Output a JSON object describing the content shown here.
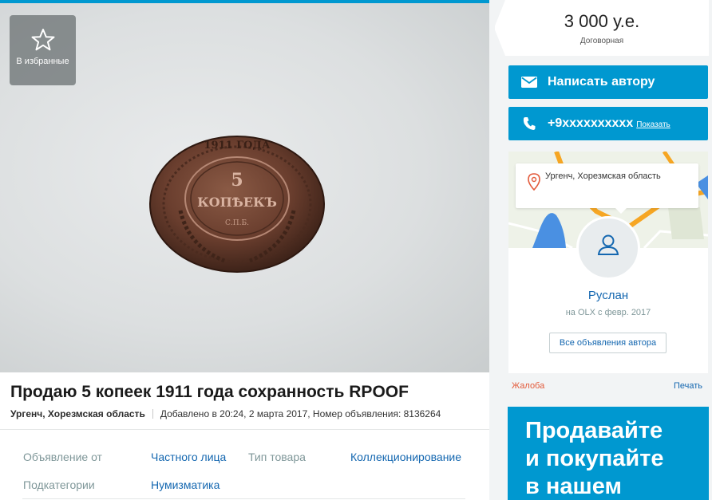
{
  "gallery": {
    "favorite_label": "В избранные"
  },
  "listing": {
    "title": "Продаю 5 копеек 1911 года сохранность RPOOF",
    "location": "Ургенч, Хорезмская область",
    "added": "Добавлено в 20:24, 2 марта 2017, Номер объявления: 8136264",
    "params": [
      {
        "label": "Объявление от",
        "value": "Частного лица"
      },
      {
        "label": "Тип товара",
        "value": "Коллекционирование"
      },
      {
        "label": "Подкатегории",
        "value": "Нумизматика"
      }
    ]
  },
  "price": {
    "amount": "3 000 у.е.",
    "note": "Договорная"
  },
  "contact": {
    "write_label": "Написать автору",
    "phone": "+9xxxxxxxxxx",
    "show_label": "Показать"
  },
  "seller": {
    "map_location": "Ургенч, Хорезмская область",
    "name": "Руслан",
    "since": "на OLX с февр. 2017",
    "all_ads_label": "Все объявления автора"
  },
  "actions": {
    "complain": "Жалоба",
    "print": "Печать"
  },
  "promo": {
    "lines": [
      "Продавайте",
      "и покупайте",
      "в нашем"
    ]
  },
  "colors": {
    "accent": "#0098d0",
    "link": "#1467b0",
    "complain": "#e35a3a"
  }
}
